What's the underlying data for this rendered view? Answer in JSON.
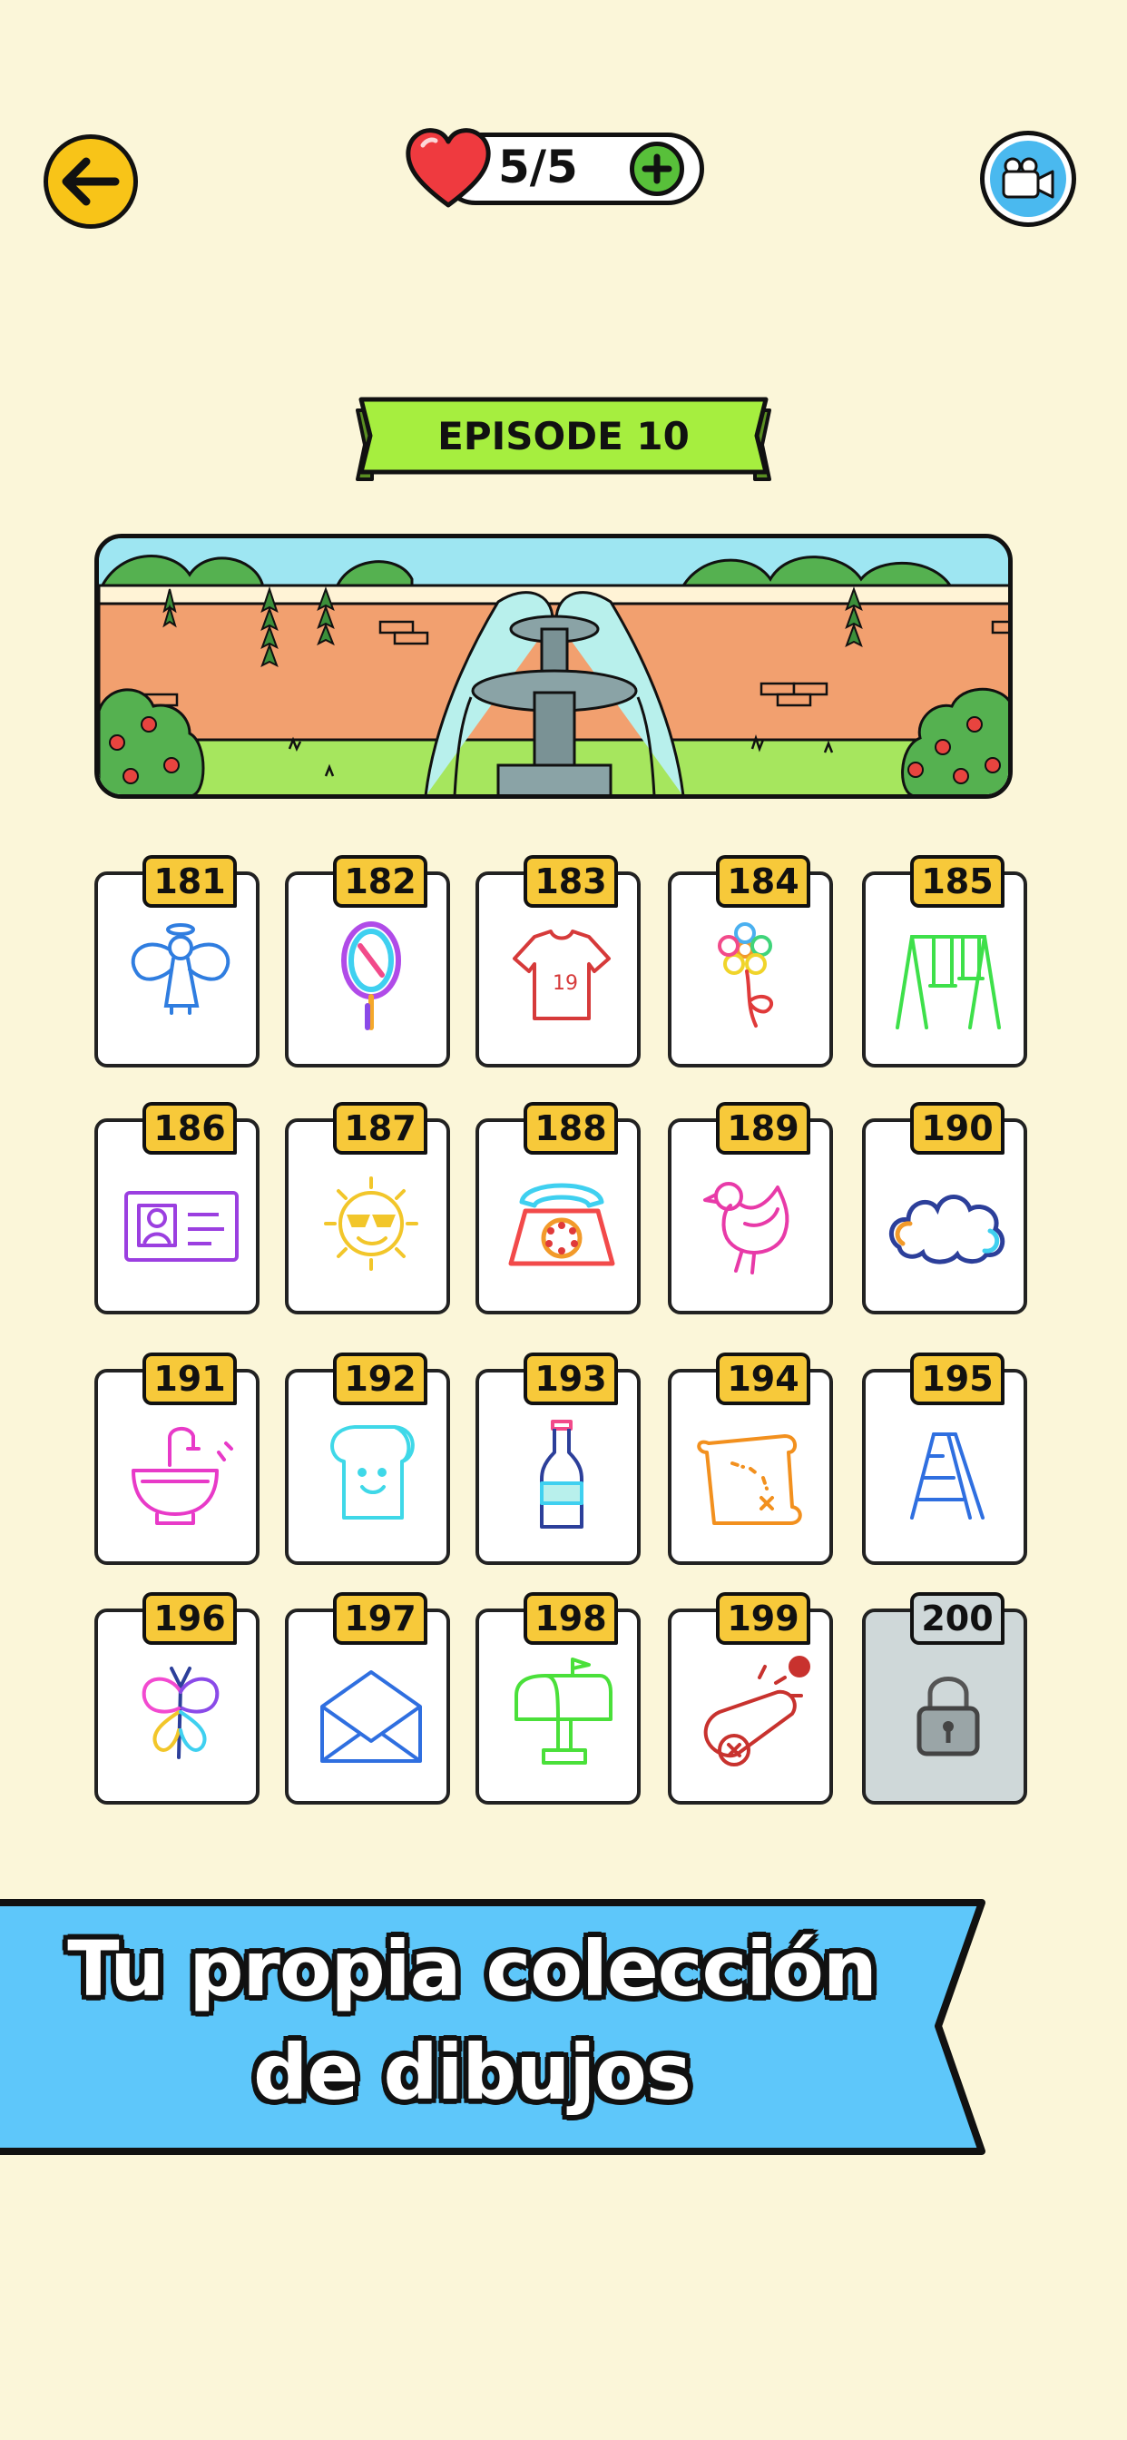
{
  "header": {
    "lives_text": "5/5"
  },
  "episode": {
    "title": "EPISODE 10"
  },
  "colors": {
    "background": "#fbf6d9",
    "accent_yellow": "#f8c418",
    "ribbon_green": "#a6ee3f",
    "promo_blue": "#5ec7fa",
    "badge_yellow": "#f7c93a",
    "locked_gray": "#cfd8d9"
  },
  "levels": [
    {
      "number": "181",
      "icon": "angel-icon",
      "locked": false
    },
    {
      "number": "182",
      "icon": "mirror-icon",
      "locked": false
    },
    {
      "number": "183",
      "icon": "tshirt-icon",
      "locked": false
    },
    {
      "number": "184",
      "icon": "flower-icon",
      "locked": false
    },
    {
      "number": "185",
      "icon": "swing-icon",
      "locked": false
    },
    {
      "number": "186",
      "icon": "id-card-icon",
      "locked": false
    },
    {
      "number": "187",
      "icon": "sun-icon",
      "locked": false
    },
    {
      "number": "188",
      "icon": "telephone-icon",
      "locked": false
    },
    {
      "number": "189",
      "icon": "bird-icon",
      "locked": false
    },
    {
      "number": "190",
      "icon": "cloud-icon",
      "locked": false
    },
    {
      "number": "191",
      "icon": "sink-icon",
      "locked": false
    },
    {
      "number": "192",
      "icon": "bread-icon",
      "locked": false
    },
    {
      "number": "193",
      "icon": "bottle-icon",
      "locked": false
    },
    {
      "number": "194",
      "icon": "treasure-map-icon",
      "locked": false
    },
    {
      "number": "195",
      "icon": "ladder-icon",
      "locked": false
    },
    {
      "number": "196",
      "icon": "butterfly-icon",
      "locked": false
    },
    {
      "number": "197",
      "icon": "envelope-icon",
      "locked": false
    },
    {
      "number": "198",
      "icon": "mailbox-icon",
      "locked": false
    },
    {
      "number": "199",
      "icon": "cannon-icon",
      "locked": false
    },
    {
      "number": "200",
      "icon": "lock-icon",
      "locked": true
    }
  ],
  "promo": {
    "line1": "Tu propia colección",
    "line2": "de dibujos"
  }
}
